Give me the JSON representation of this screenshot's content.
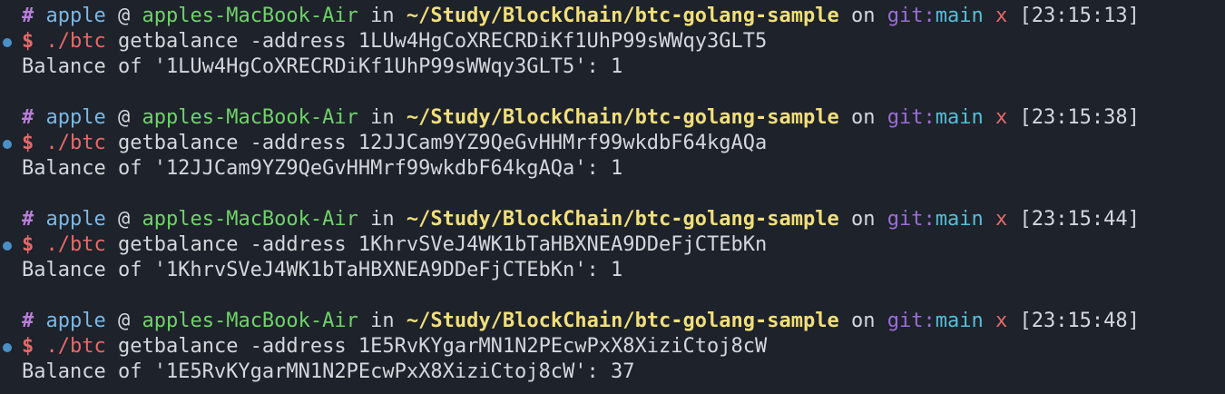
{
  "prompt_parts": {
    "hash": "#",
    "user": "apple",
    "at": "@",
    "host": "apples-MacBook-Air",
    "in": "in",
    "path": "~/Study/BlockChain/btc-golang-sample",
    "on": "on",
    "git_label": "git:",
    "branch": "main",
    "dirty": "x",
    "dollar": "$"
  },
  "colors": {
    "background": "#1e222a",
    "user": "#7ab8e6",
    "host": "#6fd36a",
    "path": "#f0df7a",
    "git_label": "#9b6fd6",
    "branch": "#54bfd9",
    "dirty": "#e56a6a",
    "command": "#e56a6a",
    "status_dot": "#4a90c8"
  },
  "entries": [
    {
      "time": "[23:15:13]",
      "cmd": "./btc",
      "args": "getbalance -address 1LUw4HgCoXRECRDiKf1UhP99sWWqy3GLT5",
      "output": "Balance of '1LUw4HgCoXRECRDiKf1UhP99sWWqy3GLT5': 1"
    },
    {
      "time": "[23:15:38]",
      "cmd": "./btc",
      "args": "getbalance -address 12JJCam9YZ9QeGvHHMrf99wkdbF64kgAQa",
      "output": "Balance of '12JJCam9YZ9QeGvHHMrf99wkdbF64kgAQa': 1"
    },
    {
      "time": "[23:15:44]",
      "cmd": "./btc",
      "args": "getbalance -address 1KhrvSVeJ4WK1bTaHBXNEA9DDeFjCTEbKn",
      "output": "Balance of '1KhrvSVeJ4WK1bTaHBXNEA9DDeFjCTEbKn': 1"
    },
    {
      "time": "[23:15:48]",
      "cmd": "./btc",
      "args": "getbalance -address 1E5RvKYgarMN1N2PEcwPxX8XiziCtoj8cW",
      "output": "Balance of '1E5RvKYgarMN1N2PEcwPxX8XiziCtoj8cW': 37"
    }
  ]
}
